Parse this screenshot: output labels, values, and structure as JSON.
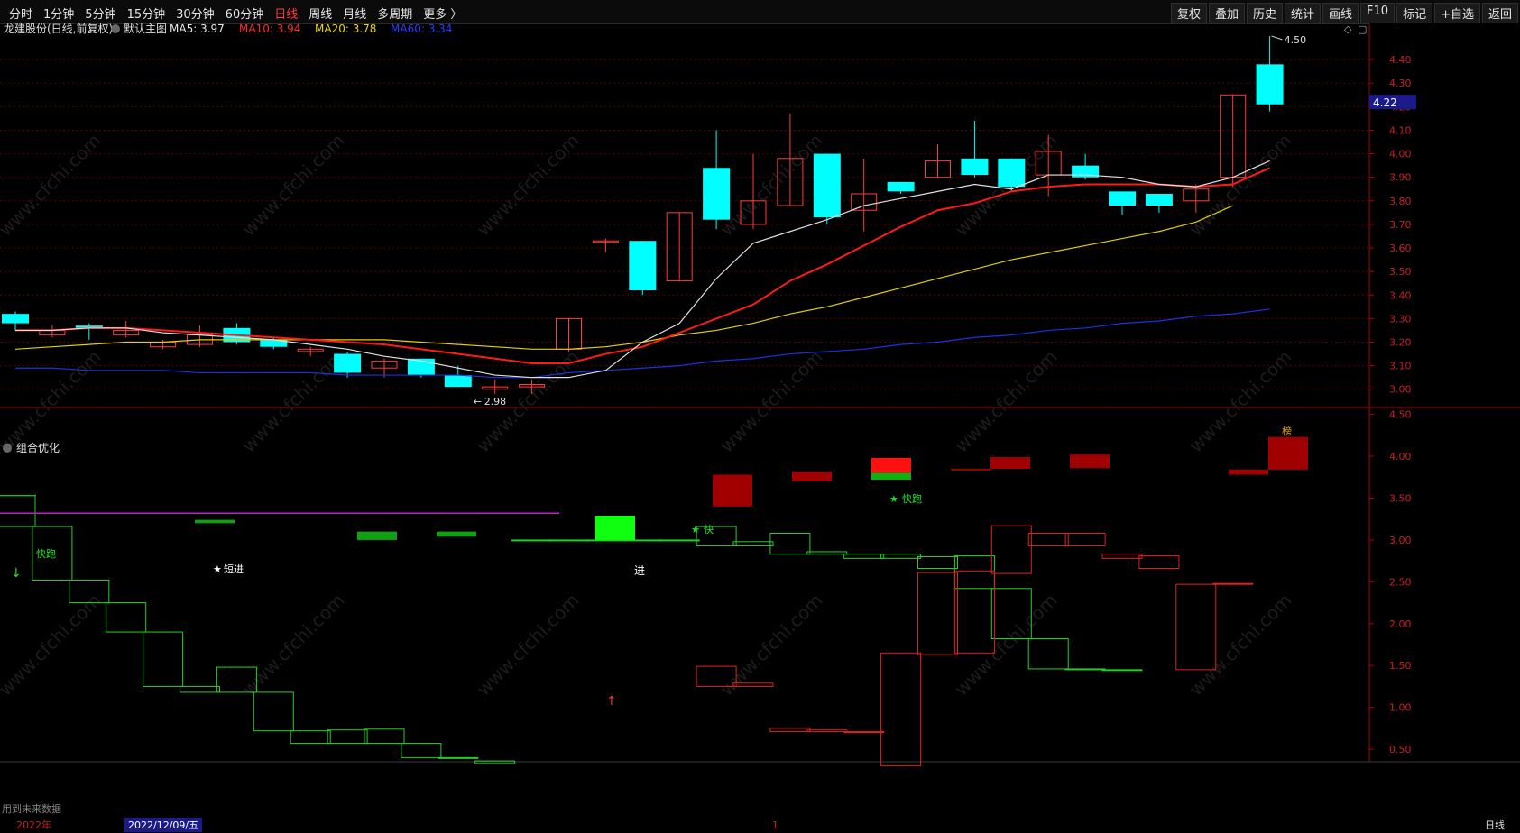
{
  "toolbar": {
    "period_tabs": [
      "分时",
      "1分钟",
      "5分钟",
      "15分钟",
      "30分钟",
      "60分钟",
      "日线",
      "周线",
      "月线",
      "多周期",
      "更多 〉"
    ],
    "active_tab": "日线",
    "right_tools": [
      "复权",
      "叠加",
      "历史",
      "统计",
      "画线",
      "F10",
      "标记",
      "+自选",
      "返回"
    ]
  },
  "main_chart": {
    "title": "龙建股份(日线,前复权)",
    "template": "默认主图",
    "ma_labels": [
      {
        "text": "MA5: 3.97",
        "color": "#e8e8e8"
      },
      {
        "text": "MA10: 3.94",
        "color": "#ff2a2a"
      },
      {
        "text": "MA20: 3.78",
        "color": "#e8d800"
      },
      {
        "text": "MA60: 3.34",
        "color": "#2a3cff"
      }
    ],
    "y_ticks": [
      "3.00",
      "3.10",
      "3.20",
      "3.30",
      "3.40",
      "3.50",
      "3.60",
      "3.70",
      "3.80",
      "3.90",
      "4.00",
      "4.10",
      "4.20",
      "4.30",
      "4.40"
    ],
    "current_price": "4.22",
    "high_label": "4.50",
    "low_label": "2.98",
    "bang_label": "榜"
  },
  "indicator": {
    "title": "组合优化",
    "y_ticks": [
      "0.50",
      "1.00",
      "1.50",
      "2.00",
      "2.50",
      "3.00",
      "3.50",
      "4.00",
      "4.50"
    ],
    "labels": {
      "fast_run_1": "快跑",
      "short_in": "短进",
      "in": "进",
      "fast_2": "快",
      "fast_run_3": "快跑"
    },
    "footnote": "用到未来数据"
  },
  "bottom_bar": {
    "year": "2022年",
    "cursor_date": "2022/12/09/五",
    "month_mark": "1",
    "period": "日线"
  },
  "watermark": "www.cfchi.com",
  "colors": {
    "up": "#ff3b3b",
    "down": "#00ffff",
    "ma5": "#e0e0e0",
    "ma10": "#ff1a1a",
    "ma20": "#e0d000",
    "ma60": "#1e30e0",
    "grid": "#5a0000",
    "axis": "#b00000",
    "green": "#00e000"
  },
  "chart_data": {
    "type": "candlestick",
    "ohlc": [
      [
        3.32,
        3.33,
        3.25,
        3.28
      ],
      [
        3.23,
        3.27,
        3.22,
        3.25
      ],
      [
        3.27,
        3.28,
        3.21,
        3.26
      ],
      [
        3.23,
        3.29,
        3.22,
        3.25
      ],
      [
        3.18,
        3.21,
        3.17,
        3.2
      ],
      [
        3.19,
        3.27,
        3.18,
        3.23
      ],
      [
        3.26,
        3.28,
        3.19,
        3.2
      ],
      [
        3.21,
        3.22,
        3.17,
        3.18
      ],
      [
        3.16,
        3.18,
        3.14,
        3.17
      ],
      [
        3.15,
        3.16,
        3.05,
        3.07
      ],
      [
        3.09,
        3.13,
        3.05,
        3.12
      ],
      [
        3.13,
        3.13,
        3.05,
        3.06
      ],
      [
        3.06,
        3.1,
        3.01,
        3.01
      ],
      [
        3.0,
        3.04,
        2.98,
        3.01
      ],
      [
        3.01,
        3.04,
        2.98,
        3.02
      ],
      [
        3.17,
        3.3,
        3.16,
        3.3
      ],
      [
        3.63,
        3.64,
        3.58,
        3.63
      ],
      [
        3.63,
        3.63,
        3.4,
        3.42
      ],
      [
        3.46,
        3.75,
        3.46,
        3.75
      ],
      [
        3.94,
        4.1,
        3.68,
        3.72
      ],
      [
        3.7,
        4.0,
        3.68,
        3.8
      ],
      [
        3.78,
        4.17,
        3.78,
        3.98
      ],
      [
        4.0,
        4.0,
        3.7,
        3.73
      ],
      [
        3.76,
        3.98,
        3.67,
        3.83
      ],
      [
        3.88,
        3.88,
        3.83,
        3.84
      ],
      [
        3.9,
        4.04,
        3.9,
        3.97
      ],
      [
        3.98,
        4.14,
        3.9,
        3.91
      ],
      [
        3.98,
        3.98,
        3.84,
        3.86
      ],
      [
        3.91,
        4.08,
        3.82,
        4.01
      ],
      [
        3.95,
        4.0,
        3.89,
        3.9
      ],
      [
        3.84,
        3.84,
        3.74,
        3.78
      ],
      [
        3.83,
        3.83,
        3.75,
        3.78
      ],
      [
        3.8,
        3.87,
        3.75,
        3.85
      ],
      [
        3.9,
        4.25,
        3.86,
        4.25
      ],
      [
        4.38,
        4.5,
        4.18,
        4.21
      ]
    ],
    "ma5": [
      3.25,
      3.25,
      3.26,
      3.26,
      3.24,
      3.23,
      3.22,
      3.21,
      3.19,
      3.17,
      3.14,
      3.12,
      3.09,
      3.06,
      3.05,
      3.05,
      3.08,
      3.2,
      3.28,
      3.47,
      3.62,
      3.67,
      3.72,
      3.78,
      3.81,
      3.84,
      3.87,
      3.85,
      3.91,
      3.91,
      3.9,
      3.87,
      3.86,
      3.9,
      3.97
    ],
    "ma10": [
      3.25,
      3.25,
      3.26,
      3.26,
      3.25,
      3.24,
      3.23,
      3.22,
      3.21,
      3.2,
      3.19,
      3.17,
      3.15,
      3.13,
      3.11,
      3.11,
      3.15,
      3.18,
      3.24,
      3.3,
      3.36,
      3.46,
      3.53,
      3.61,
      3.69,
      3.76,
      3.79,
      3.84,
      3.86,
      3.87,
      3.87,
      3.87,
      3.86,
      3.87,
      3.94
    ],
    "ma20": [
      3.17,
      3.18,
      3.19,
      3.2,
      3.2,
      3.21,
      3.21,
      3.21,
      3.21,
      3.21,
      3.21,
      3.2,
      3.19,
      3.18,
      3.17,
      3.17,
      3.18,
      3.2,
      3.23,
      3.25,
      3.28,
      3.32,
      3.35,
      3.39,
      3.43,
      3.47,
      3.51,
      3.55,
      3.58,
      3.61,
      3.64,
      3.67,
      3.71,
      3.78
    ],
    "ma60": [
      3.09,
      3.09,
      3.08,
      3.08,
      3.08,
      3.07,
      3.07,
      3.07,
      3.07,
      3.06,
      3.06,
      3.06,
      3.06,
      3.05,
      3.05,
      3.07,
      3.08,
      3.09,
      3.1,
      3.12,
      3.13,
      3.15,
      3.16,
      3.17,
      3.19,
      3.2,
      3.22,
      3.23,
      3.25,
      3.26,
      3.28,
      3.29,
      3.31,
      3.32,
      3.34
    ],
    "ylim": [
      2.93,
      4.5
    ],
    "indicator_ylim": [
      0.35,
      4.55
    ],
    "indicator_steps": {
      "green_upper": [
        3.53,
        3.16,
        2.52,
        2.25,
        1.9,
        1.25,
        1.48,
        1.18,
        0.72,
        0.73,
        0.74,
        0.57,
        0.4,
        0.36,
        3.0,
        3.0,
        3.0,
        3.0,
        3.0,
        3.16,
        2.93,
        3.08,
        2.86,
        2.83,
        2.83,
        2.66,
        2.81,
        2.42,
        1.82,
        1.46,
        1.45
      ],
      "green_lower": [
        3.16,
        2.52,
        2.25,
        1.9,
        1.25,
        1.18,
        1.18,
        0.72,
        0.57,
        0.57,
        0.57,
        0.4,
        0.4,
        0.33,
        3.0,
        3.0,
        3.0,
        3.0,
        3.0,
        2.93,
        2.98,
        2.83,
        2.83,
        2.78,
        2.78,
        2.8,
        2.42,
        1.82,
        1.46,
        1.45,
        1.45
      ],
      "red_upper": [
        1.49,
        1.29,
        0.75,
        0.73,
        0.71,
        1.65,
        2.61,
        2.63,
        3.17,
        3.08,
        3.08,
        2.83,
        2.81,
        2.47,
        2.48
      ],
      "red_lower": [
        1.25,
        1.25,
        0.71,
        0.71,
        0.71,
        0.3,
        1.63,
        1.65,
        2.6,
        2.93,
        2.93,
        2.78,
        2.66,
        1.45,
        2.47
      ]
    }
  }
}
